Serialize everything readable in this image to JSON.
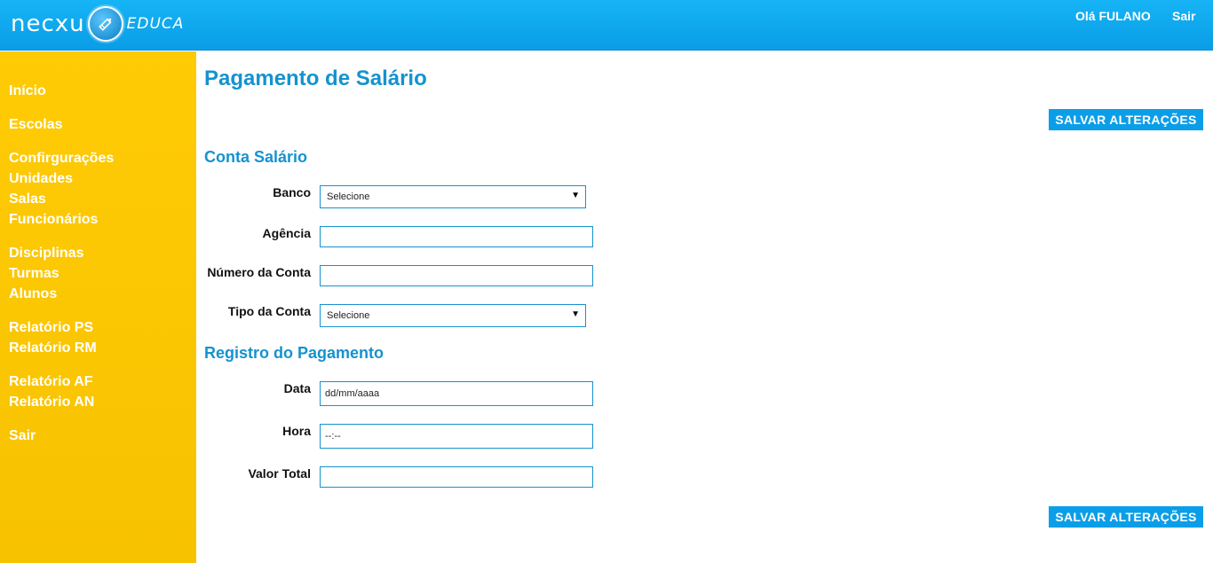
{
  "header": {
    "logo_left": "necxu",
    "logo_right": "EDUCA",
    "greeting": "Olá FULANO",
    "logout": "Sair"
  },
  "sidebar": {
    "items": [
      {
        "label": "Início"
      },
      {
        "label": "Escolas"
      },
      {
        "label": "Confirgurações"
      },
      {
        "label": "Unidades"
      },
      {
        "label": "Salas"
      },
      {
        "label": "Funcionários"
      },
      {
        "label": "Disciplinas"
      },
      {
        "label": "Turmas"
      },
      {
        "label": "Alunos"
      },
      {
        "label": "Relatório PS"
      },
      {
        "label": "Relatório RM"
      },
      {
        "label": "Relatório AF"
      },
      {
        "label": "Relatório AN"
      },
      {
        "label": "Sair"
      }
    ]
  },
  "page": {
    "title": "Pagamento de Salário",
    "save_label": "SALVAR ALTERAÇÕES"
  },
  "account_section": {
    "title": "Conta Salário",
    "bank_label": "Banco",
    "bank_value": "Selecione",
    "agency_label": "Agência",
    "agency_value": "",
    "account_number_label": "Número da Conta",
    "account_number_value": "",
    "account_type_label": "Tipo da Conta",
    "account_type_value": "Selecione"
  },
  "payment_section": {
    "title": "Registro do Pagamento",
    "date_label": "Data",
    "date_placeholder": "dd/mm/aaaa",
    "time_label": "Hora",
    "time_placeholder": "--:--",
    "total_label": "Valor Total",
    "total_value": ""
  },
  "colors": {
    "header_blue": "#0ba5ec",
    "sidebar_yellow": "#fcc500",
    "accent_blue": "#1592d0"
  }
}
